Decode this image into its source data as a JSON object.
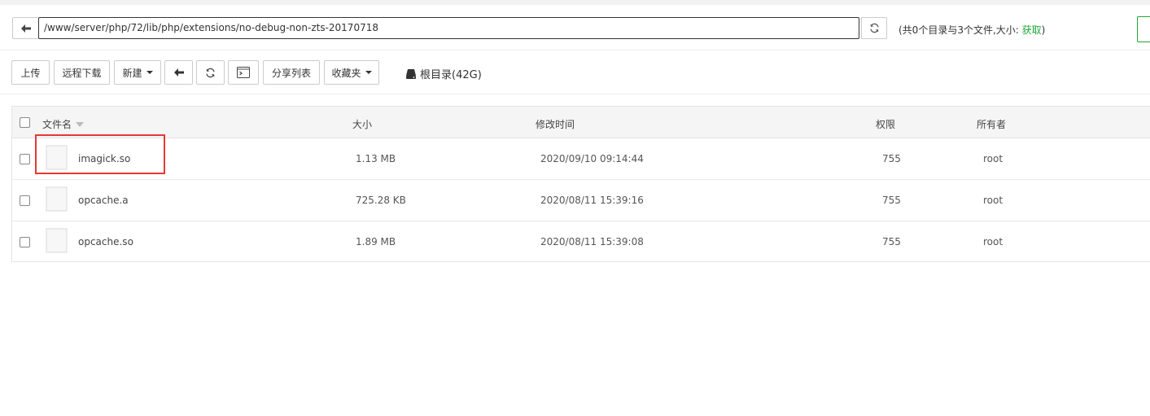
{
  "path_bar": {
    "path": "/www/server/php/72/lib/php/extensions/no-debug-non-zts-20170718",
    "dir_info_prefix": "(共0个目录与3个文件,大小: ",
    "dir_info_fetch": "获取",
    "dir_info_suffix": ")"
  },
  "toolbar": {
    "upload": "上传",
    "remote_download": "远程下载",
    "new": "新建",
    "share_list": "分享列表",
    "favorites": "收藏夹",
    "root_dir": "根目录(42G)"
  },
  "table": {
    "headers": {
      "name": "文件名",
      "size": "大小",
      "mtime": "修改时间",
      "perm": "权限",
      "owner": "所有者"
    },
    "rows": [
      {
        "name": "imagick.so",
        "size": "1.13 MB",
        "mtime": "2020/09/10 09:14:44",
        "perm": "755",
        "owner": "root",
        "highlighted": true
      },
      {
        "name": "opcache.a",
        "size": "725.28 KB",
        "mtime": "2020/08/11 15:39:16",
        "perm": "755",
        "owner": "root"
      },
      {
        "name": "opcache.so",
        "size": "1.89 MB",
        "mtime": "2020/08/11 15:39:08",
        "perm": "755",
        "owner": "root"
      }
    ]
  },
  "colors": {
    "accent_green": "#20a53a",
    "highlight_red": "#e53935"
  },
  "icons": [
    "arrow-left-icon",
    "refresh-icon",
    "terminal-icon",
    "drive-icon",
    "file-icon",
    "sort-caret-icon",
    "caret-down-icon"
  ]
}
